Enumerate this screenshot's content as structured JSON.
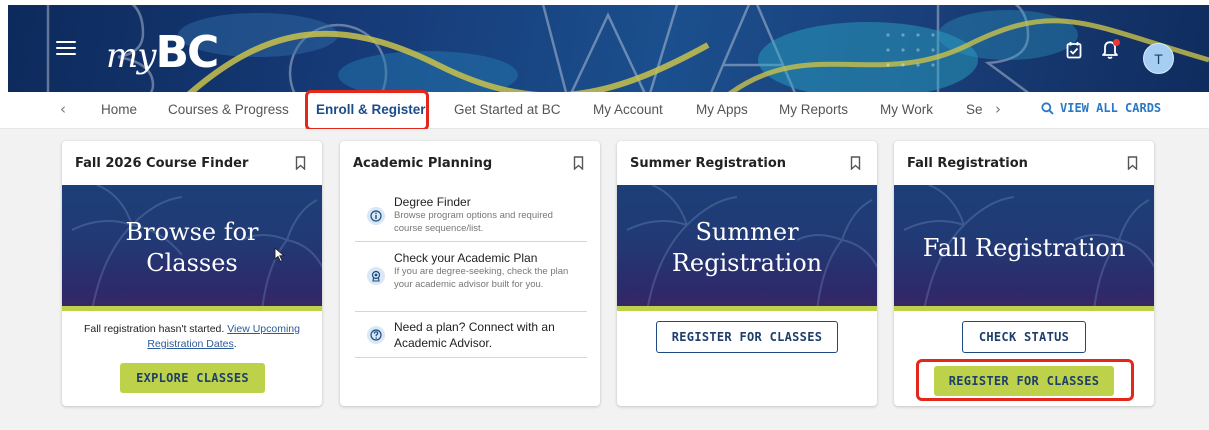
{
  "app": {
    "logo_my": "my",
    "logo_bc": "BC",
    "user_initial": "T"
  },
  "icons": {
    "menu": "hamburger-menu-icon",
    "calendar": "calendar-check-icon",
    "notifications": "bell-icon",
    "search": "search-icon",
    "bookmark": "bookmark-icon"
  },
  "colors": {
    "accent_green": "#bdd14a",
    "nav_active": "#1a4b8c",
    "link_blue": "#2b78c5",
    "highlight_red": "#e5261b",
    "notification_dot": "#e53935"
  },
  "nav": {
    "items": [
      {
        "label": "Home"
      },
      {
        "label": "Courses & Progress"
      },
      {
        "label": "Enroll & Register",
        "active": true
      },
      {
        "label": "Get Started at BC"
      },
      {
        "label": "My Account"
      },
      {
        "label": "My Apps"
      },
      {
        "label": "My Reports"
      },
      {
        "label": "My Work"
      },
      {
        "label": "Se"
      }
    ],
    "prev_arrow": "‹",
    "next_arrow": "›",
    "view_all": "VIEW ALL CARDS"
  },
  "cards": [
    {
      "title": "Fall 2026 Course Finder",
      "hero_line1": "Browse for",
      "hero_line2": "Classes",
      "note_text": "Fall registration hasn't started.",
      "note_link": "View Upcoming Registration Dates",
      "note_end": ".",
      "button": "EXPLORE CLASSES"
    },
    {
      "title": "Academic Planning",
      "items": [
        {
          "icon": "info-icon",
          "title": "Degree Finder",
          "desc": "Browse program options and required course sequence/list."
        },
        {
          "icon": "academic-plan-icon",
          "title": "Check your Academic Plan",
          "desc": "If you are degree-seeking, check the plan your academic advisor built for you."
        },
        {
          "icon": "help-icon",
          "title": "Need a plan? Connect with an Academic Advisor.",
          "desc": ""
        }
      ]
    },
    {
      "title": "Summer Registration",
      "hero_line1": "Summer",
      "hero_line2": "Registration",
      "button": "REGISTER FOR CLASSES"
    },
    {
      "title": "Fall Registration",
      "hero_line1": "Fall Registration",
      "button_status": "CHECK STATUS",
      "button_register": "REGISTER FOR CLASSES"
    }
  ]
}
